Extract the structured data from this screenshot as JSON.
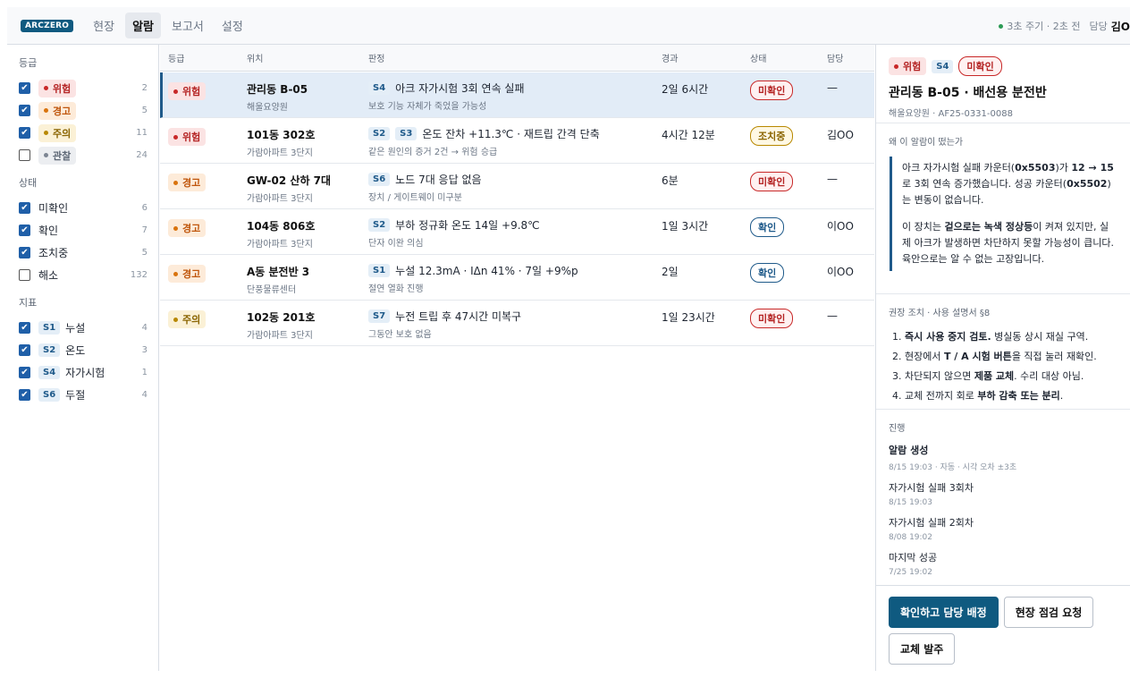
{
  "app": {
    "logo": "ARCZERO"
  },
  "nav": [
    "현장",
    "알람",
    "보고서",
    "설정"
  ],
  "nav_active": 1,
  "topbar": {
    "refresh": "3초 주기",
    "sep": "·",
    "updated": "2초 전",
    "owner_label": "담당",
    "owner_name": "김O"
  },
  "sidebar": {
    "grade_title": "등급",
    "grades": [
      {
        "label": "위험",
        "count": "2",
        "checked": true
      },
      {
        "label": "경고",
        "count": "5",
        "checked": true
      },
      {
        "label": "주의",
        "count": "11",
        "checked": true
      },
      {
        "label": "관찰",
        "count": "24",
        "checked": false
      }
    ],
    "status_title": "상태",
    "statuses": [
      {
        "label": "미확인",
        "count": "6",
        "checked": true
      },
      {
        "label": "확인",
        "count": "7",
        "checked": true
      },
      {
        "label": "조치중",
        "count": "5",
        "checked": true
      },
      {
        "label": "해소",
        "count": "132",
        "checked": false
      }
    ],
    "metric_title": "지표",
    "metrics": [
      {
        "code": "S1",
        "label": "누설",
        "count": "4",
        "checked": true
      },
      {
        "code": "S2",
        "label": "온도",
        "count": "3",
        "checked": true
      },
      {
        "code": "S4",
        "label": "자가시험",
        "count": "1",
        "checked": true
      },
      {
        "code": "S6",
        "label": "두절",
        "count": "4",
        "checked": true
      }
    ]
  },
  "list": {
    "headers": [
      "등급",
      "위치",
      "판정",
      "경과",
      "상태",
      "담당"
    ],
    "rows": [
      {
        "grade": "위험",
        "loc": "관리동 B-05",
        "site": "해울요양원",
        "codes": [
          "S4"
        ],
        "judge": "아크 자가시험 3회 연속 실패",
        "judge_sub": "보호 기능 자체가 죽었을 가능성",
        "elapsed": "2일 6시간",
        "status": "미확인",
        "owner": "—"
      },
      {
        "grade": "위험",
        "loc": "101동 302호",
        "site": "가람아파트 3단지",
        "codes": [
          "S2",
          "S3"
        ],
        "judge": "온도 잔차 +11.3℃ · 재트립 간격 단축",
        "judge_sub": "같은 원인의 증거 2건 → 위험 승급",
        "elapsed": "4시간 12분",
        "status": "조치중",
        "owner": "김OO"
      },
      {
        "grade": "경고",
        "loc": "GW-02 산하 7대",
        "site": "가람아파트 3단지",
        "codes": [
          "S6"
        ],
        "judge": "노드 7대 응답 없음",
        "judge_sub": "장치 / 게이트웨이 미구분",
        "elapsed": "6분",
        "status": "미확인",
        "owner": "—"
      },
      {
        "grade": "경고",
        "loc": "104동 806호",
        "site": "가람아파트 3단지",
        "codes": [
          "S2"
        ],
        "judge": "부하 정규화 온도 14일 +9.8℃",
        "judge_sub": "단자 이완 의심",
        "elapsed": "1일 3시간",
        "status": "확인",
        "owner": "이OO"
      },
      {
        "grade": "경고",
        "loc": "A동 분전반 3",
        "site": "단풍물류센터",
        "codes": [
          "S1"
        ],
        "judge": "누설 12.3mA · IΔn 41% · 7일 +9%p",
        "judge_sub": "절연 열화 진행",
        "elapsed": "2일",
        "status": "확인",
        "owner": "이OO"
      },
      {
        "grade": "주의",
        "loc": "102동 201호",
        "site": "가람아파트 3단지",
        "codes": [
          "S7"
        ],
        "judge": "누전 트립 후 47시간 미복구",
        "judge_sub": "그동안 보호 없음",
        "elapsed": "1일 23시간",
        "status": "미확인",
        "owner": "—"
      }
    ]
  },
  "detail": {
    "grade": "위험",
    "code": "S4",
    "status": "미확인",
    "title": "관리동 B-05 · 배선용 분전반",
    "sub": "해울요양원 · AF25-0331-0088",
    "why_label": "왜 이 알람이 떴는가",
    "why_p1": [
      "아크 자가시험 실패 카운터(",
      "0x5503",
      ")가 ",
      "12 → 15",
      "로 3회 연속 증가했습니다. 성공 카운터(",
      "0x5502",
      ")는 변동이 없습니다."
    ],
    "why_p2": [
      "이 장치는 ",
      "겉으로는 녹색 정상등",
      "이 켜져 있지만, 실제 아크가 발생하면 차단하지 못할 가능성이 큽니다. 육안으로는 알 수 없는 고장입니다."
    ],
    "action_label": "권장 조치",
    "action_ref": "· 사용 설명서 §8",
    "steps": [
      [
        "1. ",
        "즉시 사용 중지 검토.",
        " 병실동 상시 재실 구역."
      ],
      [
        "2. 현장에서 ",
        "T / A 시험 버튼",
        "을 직접 눌러 재확인."
      ],
      [
        "3. 차단되지 않으면 ",
        "제품 교체",
        ". 수리 대상 아님."
      ],
      [
        "4. 교체 전까지 회로 ",
        "부하 감축 또는 분리",
        "."
      ]
    ],
    "progress_label": "진행",
    "progress": [
      {
        "title": "알람 생성",
        "meta": "8/15 19:03 · 자동 · 시각 오차 ±3초",
        "bold": true
      },
      {
        "title": "자가시험 실패 3회차",
        "meta": "8/15 19:03",
        "bold": false
      },
      {
        "title": "자가시험 실패 2회차",
        "meta": "8/08 19:02",
        "bold": false
      },
      {
        "title": "마지막 성공",
        "meta": "7/25 19:02",
        "bold": false
      }
    ],
    "buttons": [
      "확인하고 담당 배정",
      "현장 점검 요청",
      "교체 발주"
    ]
  },
  "colors": {
    "accent": "#0f5a80",
    "danger": "#c82828",
    "warning": "#d9730d",
    "caution": "#b88800",
    "selected_row": "#e2ecf7"
  }
}
